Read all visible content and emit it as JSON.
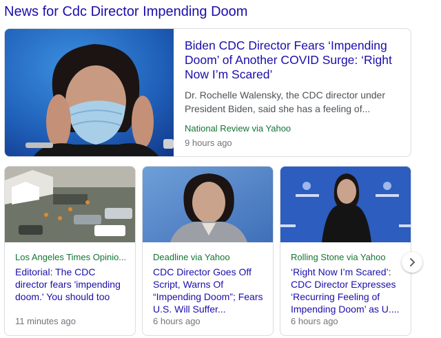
{
  "heading": "News for Cdc Director Impending Doom",
  "top_story": {
    "title": "Biden CDC Director Fears ‘Impending Doom’ of Another COVID Surge: ‘Right Now I’m Scared’",
    "snippet": "Dr. Rochelle Walensky, the CDC director under President Biden, said she has a feeling of...",
    "source": "National Review via Yahoo",
    "time": "9 hours ago"
  },
  "stories": [
    {
      "source": "Los Angeles Times Opinio...",
      "title": "Editorial: The CDC director fears 'impending doom.' You should too",
      "time": "11 minutes ago"
    },
    {
      "source": "Deadline via Yahoo",
      "title": "CDC Director Goes Off Script, Warns Of “Impending Doom”; Fears U.S. Will Suffer...",
      "time": "6 hours ago"
    },
    {
      "source": "Rolling Stone via Yahoo",
      "title": "‘Right Now I’m Scared’: CDC Director Expresses ‘Recurring Feeling of Impending Doom’ as U....",
      "time": "6 hours ago"
    }
  ],
  "next_icon": "chevron-right-icon",
  "colors": {
    "link": "#1a0dab",
    "source": "#137333",
    "meta": "#70757a",
    "snippet": "#4d5156"
  }
}
